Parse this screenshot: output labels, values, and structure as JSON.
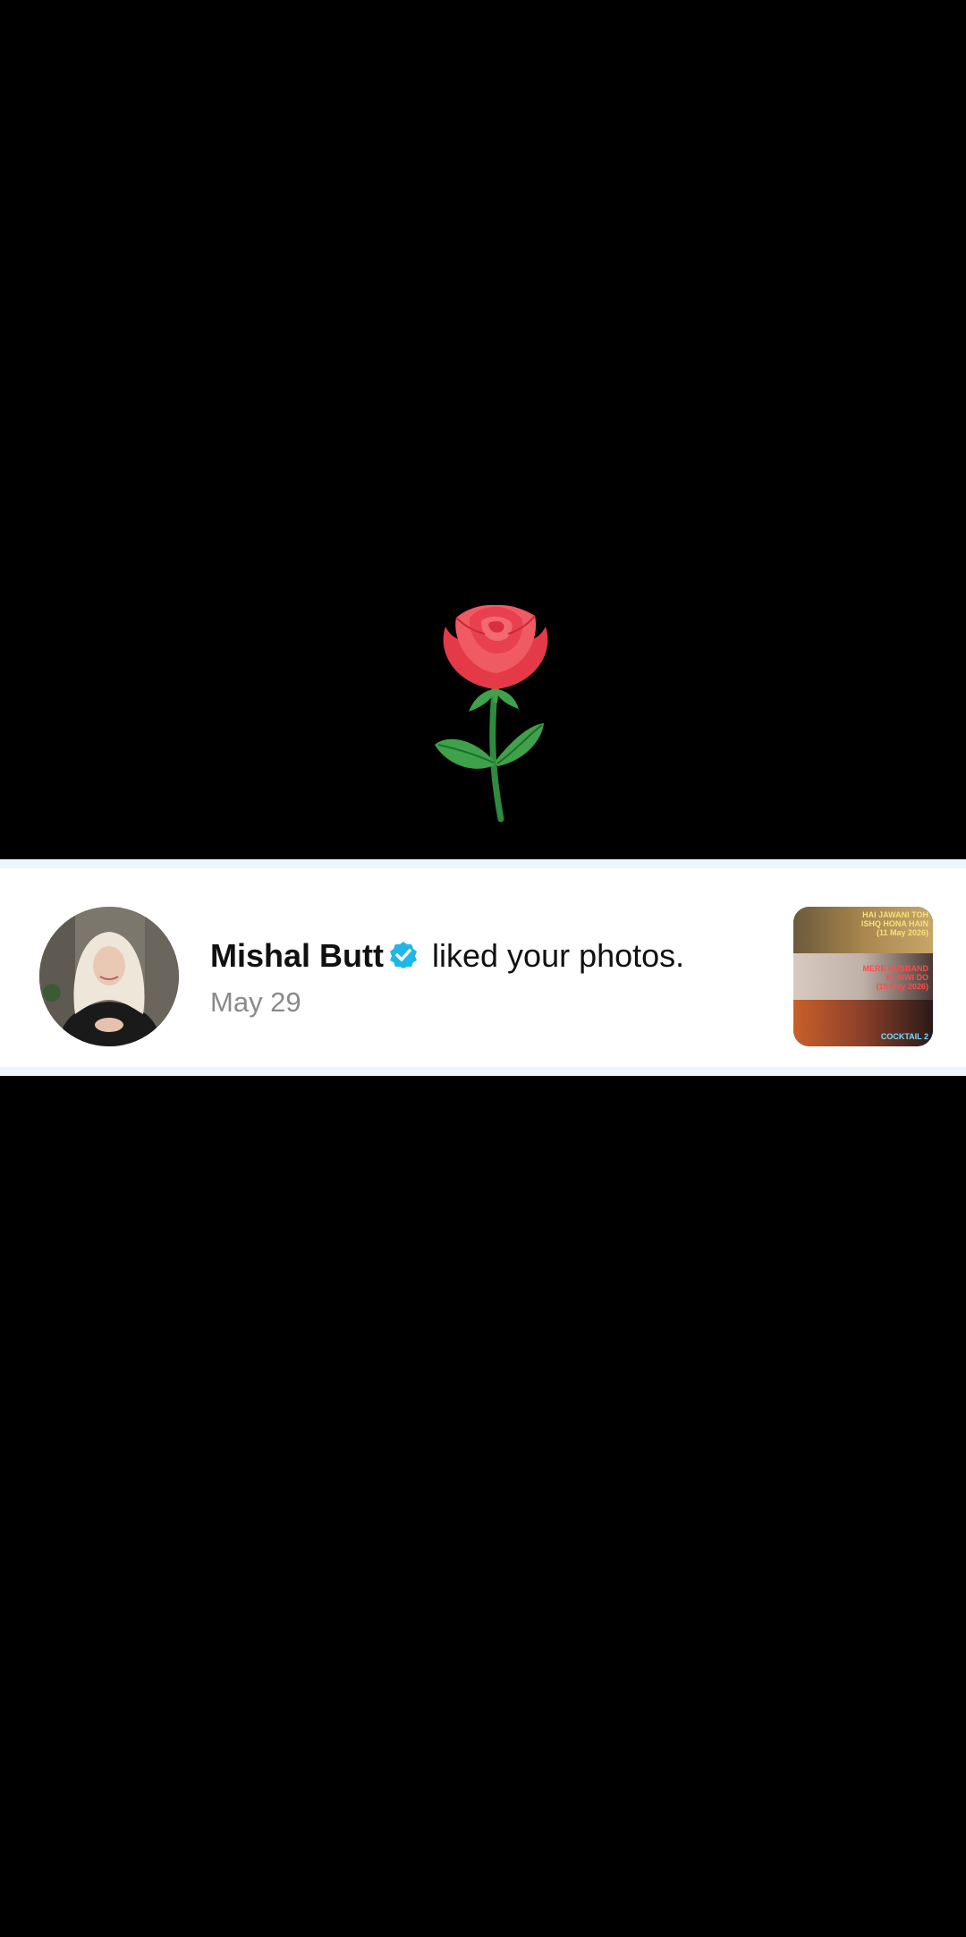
{
  "notification": {
    "username": "Mishal Butt",
    "action": " liked your photos.",
    "date": "May 29"
  },
  "icons": {
    "rose": "rose-emoji-icon",
    "verified": "verified-badge-icon"
  },
  "thumbnail": {
    "panels": [
      {
        "text": "HAI JAWANI TOH\nISHQ HONA HAIN\n(11 May 2026)"
      },
      {
        "text": "MERE HUSBAND\nKI BIWI DO\n(15 May 2026)"
      },
      {
        "text": "COCKTAIL 2"
      }
    ]
  },
  "colors": {
    "background": "#000000",
    "card": "#ffffff",
    "card_border": "#eaf7fb",
    "verified": "#1fb8e6",
    "date_text": "#8a8a8a"
  }
}
